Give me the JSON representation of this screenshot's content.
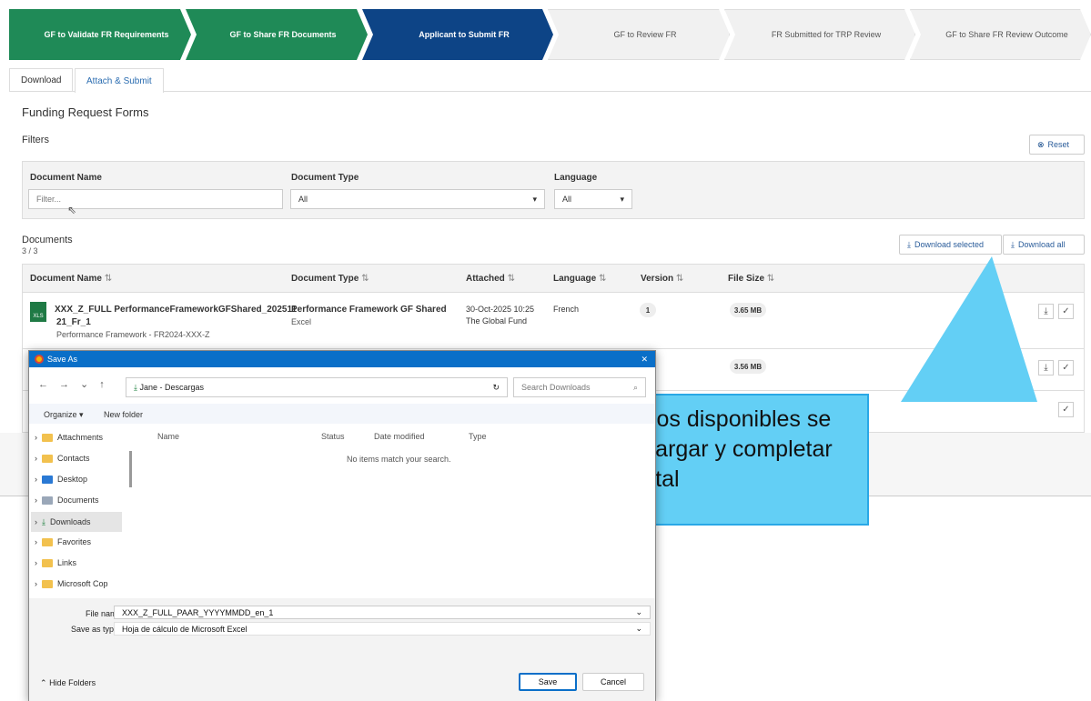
{
  "steps": [
    "GF to Validate FR Requirements",
    "GF to Share FR Documents",
    "Applicant to Submit FR",
    "GF to Review FR",
    "FR Submitted for TRP Review",
    "GF to Share FR Review Outcome"
  ],
  "tabs": {
    "download": "Download",
    "attach": "Attach & Submit"
  },
  "page_title": "Funding Request Forms",
  "filters": {
    "label": "Filters",
    "reset": "Reset",
    "doc_name": "Document Name",
    "doc_name_ph": "Filter...",
    "doc_type": "Document Type",
    "doc_type_val": "All",
    "language": "Language",
    "language_val": "All"
  },
  "documents": {
    "label": "Documents",
    "count": "3 / 3",
    "download_selected": "Download selected",
    "download_all": "Download all",
    "columns": [
      "Document Name",
      "Document Type",
      "Attached",
      "Language",
      "Version",
      "File Size"
    ],
    "row1": {
      "name": "XXX_Z_FULL PerformanceFrameworkGFShared_202511",
      "name2": "21_Fr_1",
      "subtitle": "Performance Framework - FR2024-XXX-Z",
      "file_tag": "XLS",
      "type": "Performance Framework GF Shared",
      "type2": "Excel",
      "date": "30-Oct-2025 10:25",
      "by": "The Global Fund",
      "language": "French",
      "version": "1",
      "size": "3.65 MB"
    },
    "row2": {
      "size": "3.56 MB"
    }
  },
  "dialog": {
    "title": "Save As",
    "path": "Jane - Descargas",
    "search_ph": "Search Downloads",
    "organize": "Organize ▾",
    "new_folder": "New folder",
    "nav": [
      "Attachments",
      "Contacts",
      "Desktop",
      "Documents",
      "Downloads",
      "Favorites",
      "Links",
      "Microsoft Cop"
    ],
    "cols": [
      "Name",
      "Status",
      "Date modified",
      "Type"
    ],
    "empty": "No items match your search.",
    "file_name_label": "File name:",
    "file_name": "XXX_Z_FULL_PAAR_YYYYMMDD_en_1",
    "save_type_label": "Save as type:",
    "save_type": "Hoja de cálculo de Microsoft Excel",
    "hide": "Hide Folders",
    "save": "Save",
    "cancel": "Cancel"
  },
  "callout": "Los formularios disponibles se pueden descargar y completar fuera del Portal"
}
